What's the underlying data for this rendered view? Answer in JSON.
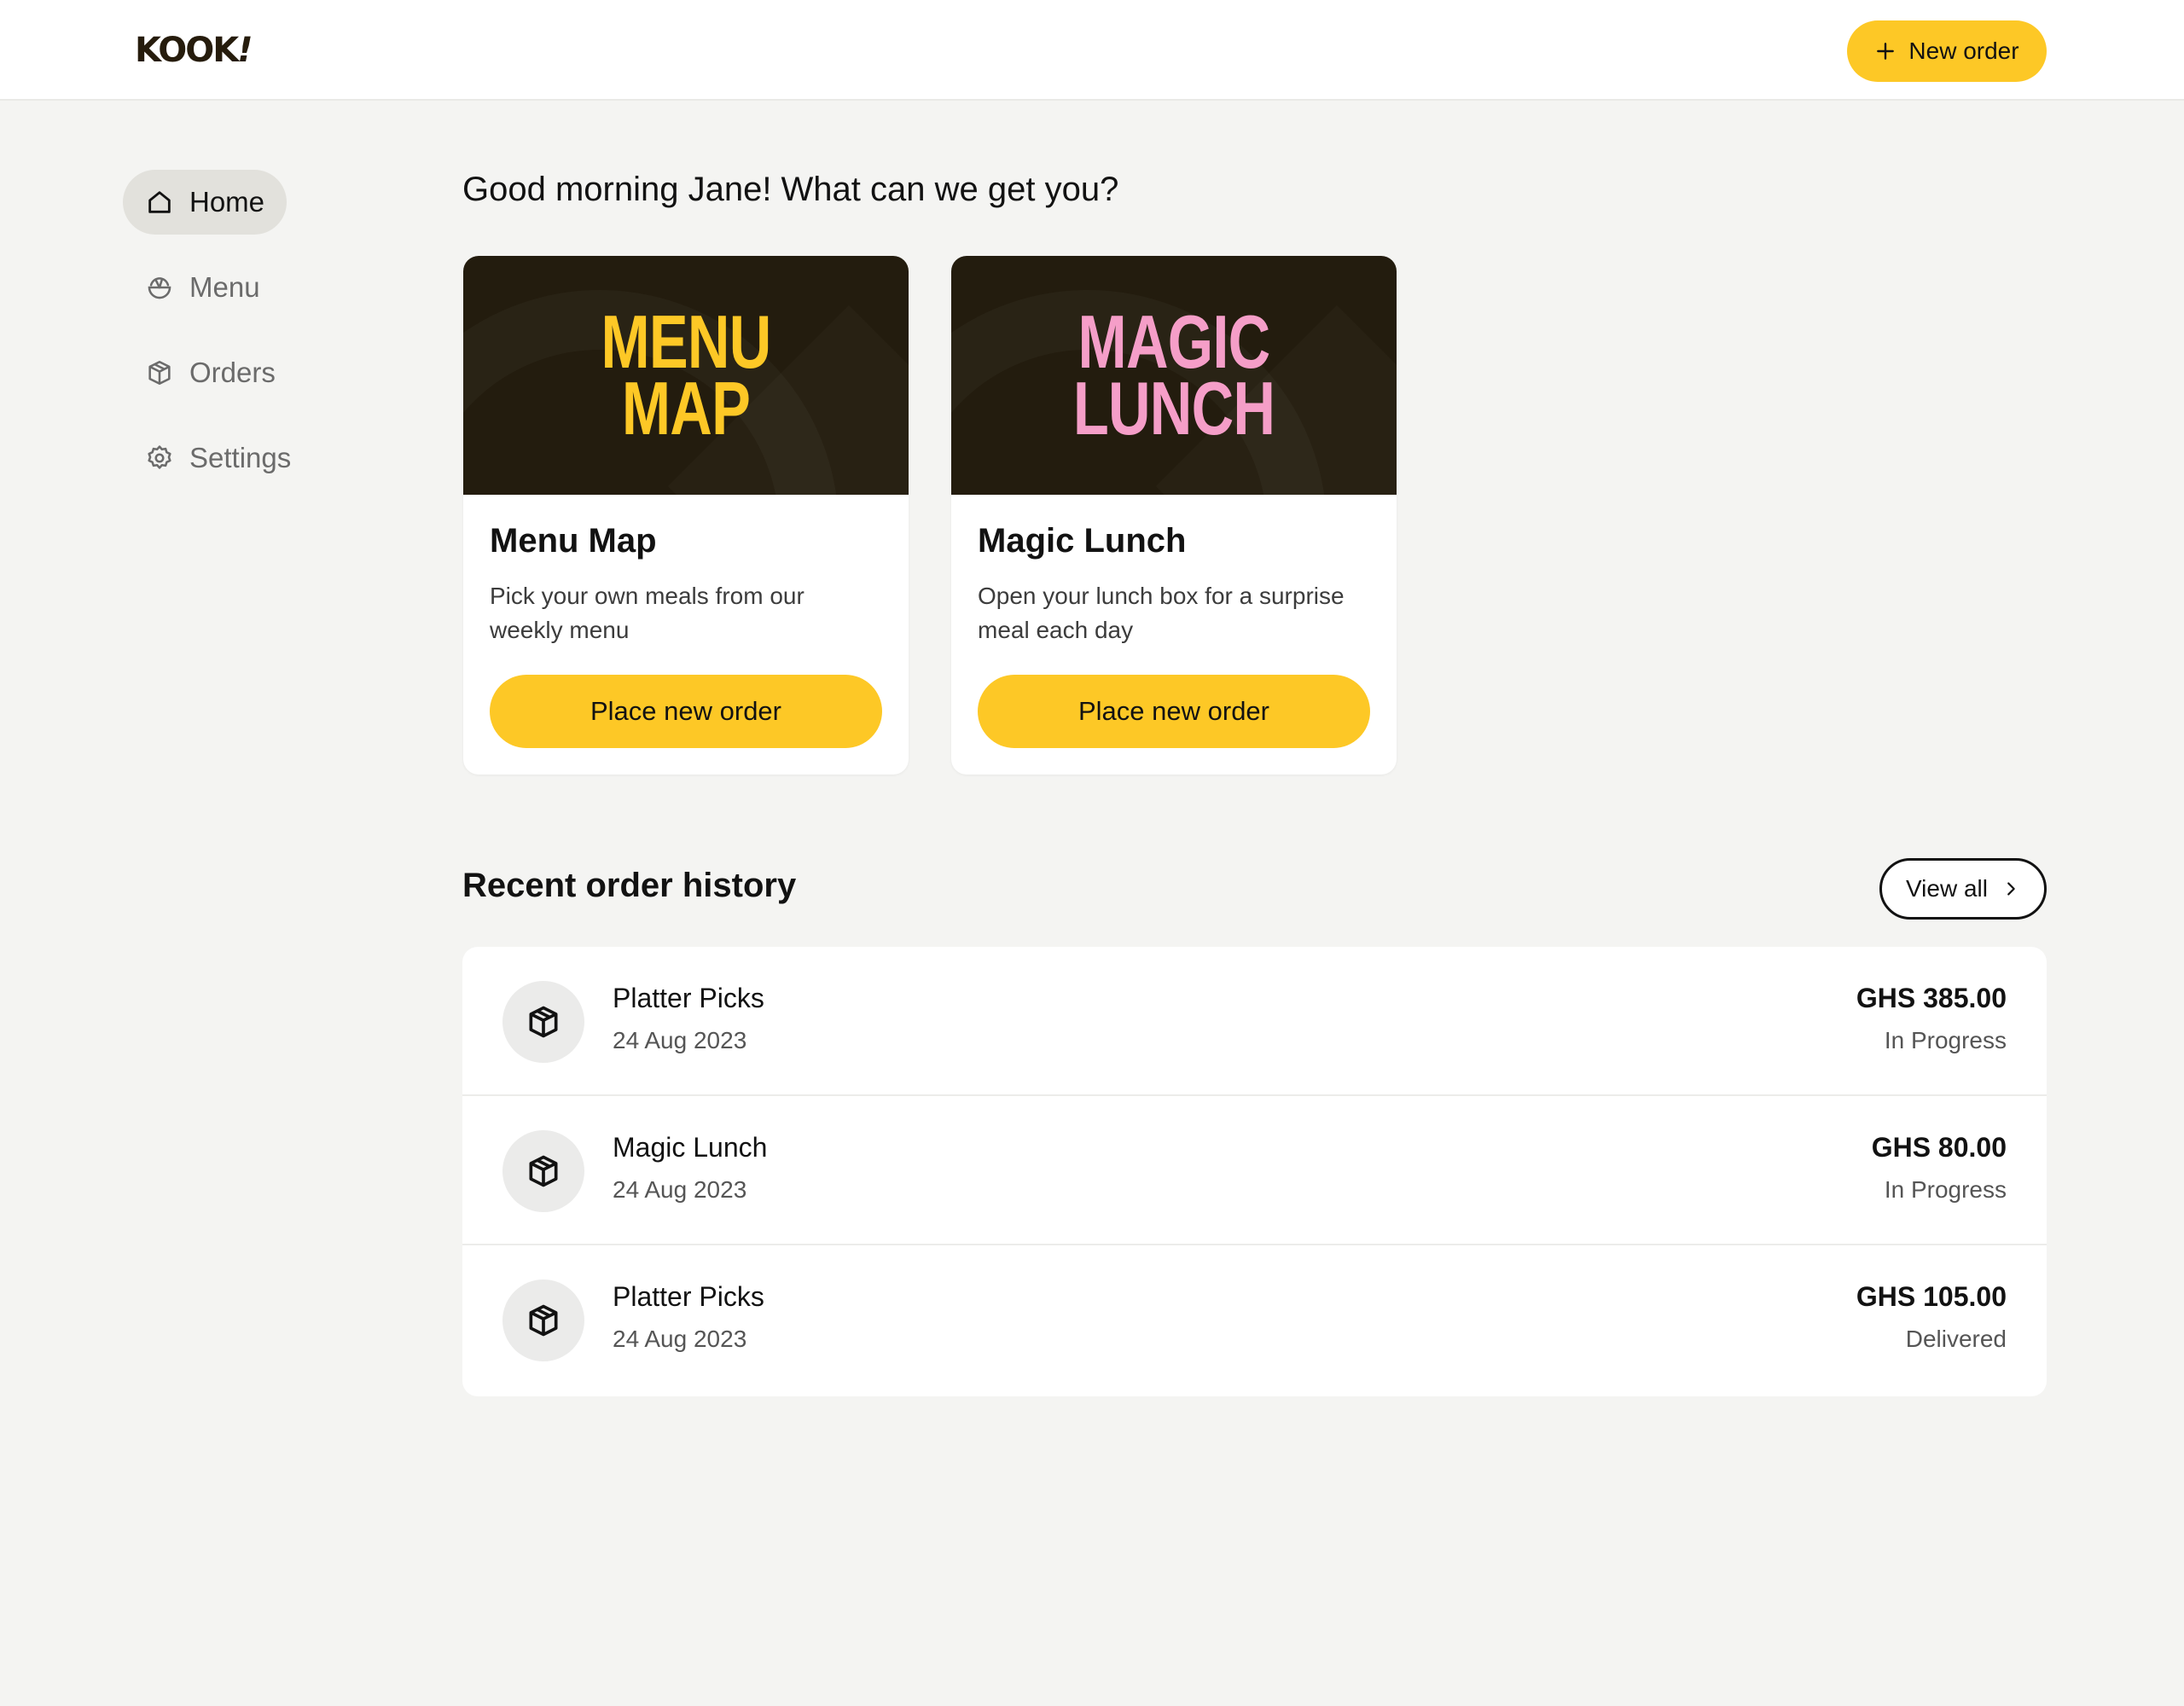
{
  "header": {
    "logo": "KOOK",
    "logo_mark": "!",
    "new_order_label": "New order"
  },
  "sidebar": {
    "items": [
      {
        "label": "Home",
        "icon": "home-icon",
        "active": true
      },
      {
        "label": "Menu",
        "icon": "bowl-icon",
        "active": false
      },
      {
        "label": "Orders",
        "icon": "box-icon",
        "active": false
      },
      {
        "label": "Settings",
        "icon": "gear-icon",
        "active": false
      }
    ]
  },
  "main": {
    "greeting": "Good morning Jane! What can we get you?",
    "cards": [
      {
        "banner_line1": "MENU",
        "banner_line2": "MAP",
        "banner_color": "#fdc826",
        "title": "Menu Map",
        "description": "Pick your own meals from our weekly menu",
        "button_label": "Place new order"
      },
      {
        "banner_line1": "MAGIC",
        "banner_line2": "LUNCH",
        "banner_color": "#f59ec8",
        "title": "Magic Lunch",
        "description": "Open your lunch box for a surprise meal each day",
        "button_label": "Place new order"
      }
    ],
    "history": {
      "title": "Recent order history",
      "view_all_label": "View all",
      "orders": [
        {
          "name": "Platter Picks",
          "date": "24 Aug 2023",
          "price": "GHS 385.00",
          "status": "In Progress"
        },
        {
          "name": "Magic Lunch",
          "date": "24 Aug 2023",
          "price": "GHS 80.00",
          "status": "In Progress"
        },
        {
          "name": "Platter Picks",
          "date": "24 Aug 2023",
          "price": "GHS 105.00",
          "status": "Delivered"
        }
      ]
    }
  },
  "colors": {
    "accent": "#fdc826",
    "banner_bg": "#231c0e",
    "page_bg": "#f4f4f2"
  }
}
